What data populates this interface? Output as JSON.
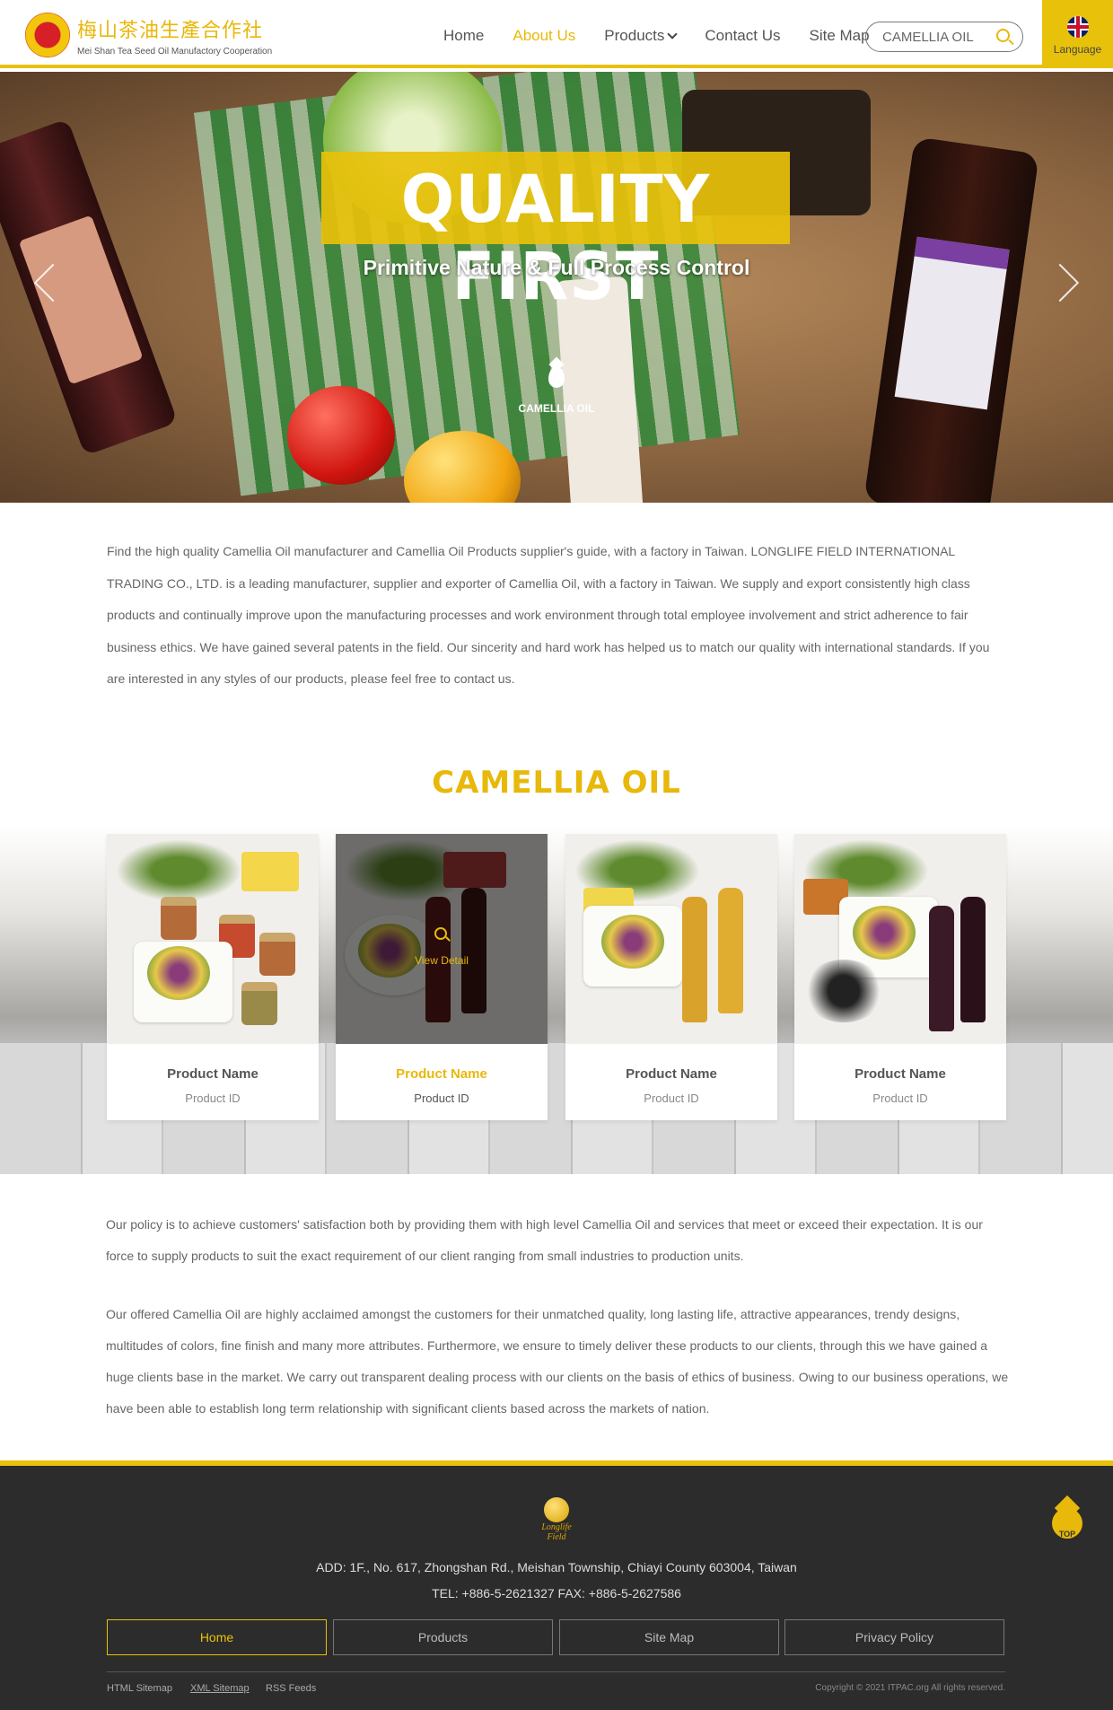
{
  "header": {
    "logo_cn": "梅山茶油生產合作社",
    "logo_en": "Mei Shan Tea Seed Oil Manufactory Cooperation",
    "nav": [
      "Home",
      "About Us",
      "Products",
      "Contact Us",
      "Site Map"
    ],
    "active_nav": "About Us",
    "search_value": "CAMELLIA OIL",
    "language_label": "Language"
  },
  "hero": {
    "title": "QUALITY FIRST",
    "subtitle": "Primitive Nature & Full Process Control",
    "caption": "CAMELLIA OIL"
  },
  "intro": "Find the high quality Camellia Oil manufacturer and Camellia Oil Products supplier's guide, with a factory in Taiwan. LONGLIFE FIELD INTERNATIONAL TRADING CO., LTD. is a leading manufacturer, supplier and exporter of Camellia Oil, with a factory in Taiwan. We supply and export consistently high class products and continually improve upon the manufacturing processes and work environment through total employee involvement and strict adherence to fair business ethics. We have gained several patents in the field. Our sincerity and hard work has helped us to match our quality with international standards. If you are interested in any styles of our products, please feel free to contact us.",
  "products": {
    "title": "CAMELLIA OIL",
    "overlay_text": "View  Detail",
    "items": [
      {
        "name": "Product Name",
        "id": "Product ID"
      },
      {
        "name": "Product Name",
        "id": "Product ID"
      },
      {
        "name": "Product Name",
        "id": "Product ID"
      },
      {
        "name": "Product Name",
        "id": "Product ID"
      }
    ]
  },
  "policy": [
    "Our policy is to achieve customers' satisfaction both by providing them with high level Camellia Oil and services that meet or exceed their expectation. It is our force to supply products to suit the exact requirement of our client ranging from small industries to production units.",
    "Our offered Camellia Oil are highly acclaimed amongst the customers for their unmatched quality, long lasting life, attractive appearances, trendy designs, multitudes of colors, fine finish and many more attributes. Furthermore, we ensure to timely deliver these products to our clients, through this we have gained a huge clients base in the market. We carry out transparent dealing process with our clients on the basis of ethics of business. Owing to our business operations, we have been able to establish long term relationship with significant clients based across the markets of nation."
  ],
  "footer": {
    "logo_text": "Longlife Field",
    "address": "ADD: 1F., No. 617, Zhongshan Rd., Meishan Township, Chiayi County 603004, Taiwan",
    "tel_fax": "TEL: +886-5-2621327    FAX: +886-5-2627586",
    "buttons": [
      "Home",
      "Products",
      "Site Map",
      "Privacy Policy"
    ],
    "links": [
      "HTML Sitemap",
      "XML Sitemap",
      "RSS Feeds"
    ],
    "copyright": "Copyright © 2021 ITPAC.org All rights reserved.",
    "top_label": "TOP"
  },
  "colors": {
    "accent": "#e8c10a",
    "footer_bg": "#2c2c2c"
  }
}
